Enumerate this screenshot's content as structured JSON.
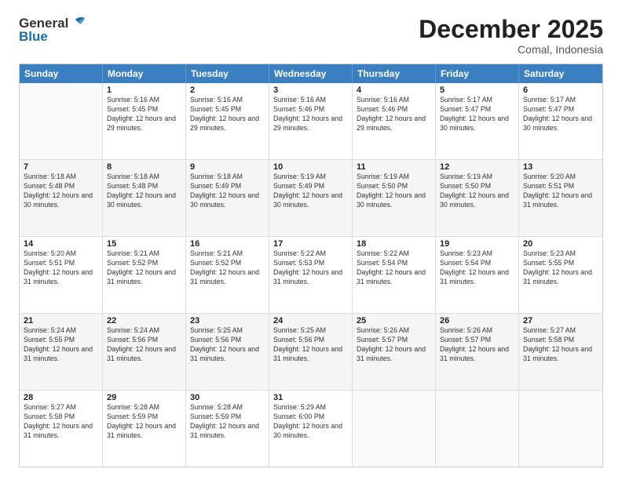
{
  "logo": {
    "general": "General",
    "blue": "Blue"
  },
  "title": "December 2025",
  "location": "Comal, Indonesia",
  "days_of_week": [
    "Sunday",
    "Monday",
    "Tuesday",
    "Wednesday",
    "Thursday",
    "Friday",
    "Saturday"
  ],
  "weeks": [
    [
      {
        "day": "",
        "sunrise": "",
        "sunset": "",
        "daylight": ""
      },
      {
        "day": "1",
        "sunrise": "Sunrise: 5:16 AM",
        "sunset": "Sunset: 5:45 PM",
        "daylight": "Daylight: 12 hours and 29 minutes."
      },
      {
        "day": "2",
        "sunrise": "Sunrise: 5:16 AM",
        "sunset": "Sunset: 5:45 PM",
        "daylight": "Daylight: 12 hours and 29 minutes."
      },
      {
        "day": "3",
        "sunrise": "Sunrise: 5:16 AM",
        "sunset": "Sunset: 5:46 PM",
        "daylight": "Daylight: 12 hours and 29 minutes."
      },
      {
        "day": "4",
        "sunrise": "Sunrise: 5:16 AM",
        "sunset": "Sunset: 5:46 PM",
        "daylight": "Daylight: 12 hours and 29 minutes."
      },
      {
        "day": "5",
        "sunrise": "Sunrise: 5:17 AM",
        "sunset": "Sunset: 5:47 PM",
        "daylight": "Daylight: 12 hours and 30 minutes."
      },
      {
        "day": "6",
        "sunrise": "Sunrise: 5:17 AM",
        "sunset": "Sunset: 5:47 PM",
        "daylight": "Daylight: 12 hours and 30 minutes."
      }
    ],
    [
      {
        "day": "7",
        "sunrise": "Sunrise: 5:18 AM",
        "sunset": "Sunset: 5:48 PM",
        "daylight": "Daylight: 12 hours and 30 minutes."
      },
      {
        "day": "8",
        "sunrise": "Sunrise: 5:18 AM",
        "sunset": "Sunset: 5:48 PM",
        "daylight": "Daylight: 12 hours and 30 minutes."
      },
      {
        "day": "9",
        "sunrise": "Sunrise: 5:18 AM",
        "sunset": "Sunset: 5:49 PM",
        "daylight": "Daylight: 12 hours and 30 minutes."
      },
      {
        "day": "10",
        "sunrise": "Sunrise: 5:19 AM",
        "sunset": "Sunset: 5:49 PM",
        "daylight": "Daylight: 12 hours and 30 minutes."
      },
      {
        "day": "11",
        "sunrise": "Sunrise: 5:19 AM",
        "sunset": "Sunset: 5:50 PM",
        "daylight": "Daylight: 12 hours and 30 minutes."
      },
      {
        "day": "12",
        "sunrise": "Sunrise: 5:19 AM",
        "sunset": "Sunset: 5:50 PM",
        "daylight": "Daylight: 12 hours and 30 minutes."
      },
      {
        "day": "13",
        "sunrise": "Sunrise: 5:20 AM",
        "sunset": "Sunset: 5:51 PM",
        "daylight": "Daylight: 12 hours and 31 minutes."
      }
    ],
    [
      {
        "day": "14",
        "sunrise": "Sunrise: 5:20 AM",
        "sunset": "Sunset: 5:51 PM",
        "daylight": "Daylight: 12 hours and 31 minutes."
      },
      {
        "day": "15",
        "sunrise": "Sunrise: 5:21 AM",
        "sunset": "Sunset: 5:52 PM",
        "daylight": "Daylight: 12 hours and 31 minutes."
      },
      {
        "day": "16",
        "sunrise": "Sunrise: 5:21 AM",
        "sunset": "Sunset: 5:52 PM",
        "daylight": "Daylight: 12 hours and 31 minutes."
      },
      {
        "day": "17",
        "sunrise": "Sunrise: 5:22 AM",
        "sunset": "Sunset: 5:53 PM",
        "daylight": "Daylight: 12 hours and 31 minutes."
      },
      {
        "day": "18",
        "sunrise": "Sunrise: 5:22 AM",
        "sunset": "Sunset: 5:54 PM",
        "daylight": "Daylight: 12 hours and 31 minutes."
      },
      {
        "day": "19",
        "sunrise": "Sunrise: 5:23 AM",
        "sunset": "Sunset: 5:54 PM",
        "daylight": "Daylight: 12 hours and 31 minutes."
      },
      {
        "day": "20",
        "sunrise": "Sunrise: 5:23 AM",
        "sunset": "Sunset: 5:55 PM",
        "daylight": "Daylight: 12 hours and 31 minutes."
      }
    ],
    [
      {
        "day": "21",
        "sunrise": "Sunrise: 5:24 AM",
        "sunset": "Sunset: 5:55 PM",
        "daylight": "Daylight: 12 hours and 31 minutes."
      },
      {
        "day": "22",
        "sunrise": "Sunrise: 5:24 AM",
        "sunset": "Sunset: 5:56 PM",
        "daylight": "Daylight: 12 hours and 31 minutes."
      },
      {
        "day": "23",
        "sunrise": "Sunrise: 5:25 AM",
        "sunset": "Sunset: 5:56 PM",
        "daylight": "Daylight: 12 hours and 31 minutes."
      },
      {
        "day": "24",
        "sunrise": "Sunrise: 5:25 AM",
        "sunset": "Sunset: 5:56 PM",
        "daylight": "Daylight: 12 hours and 31 minutes."
      },
      {
        "day": "25",
        "sunrise": "Sunrise: 5:26 AM",
        "sunset": "Sunset: 5:57 PM",
        "daylight": "Daylight: 12 hours and 31 minutes."
      },
      {
        "day": "26",
        "sunrise": "Sunrise: 5:26 AM",
        "sunset": "Sunset: 5:57 PM",
        "daylight": "Daylight: 12 hours and 31 minutes."
      },
      {
        "day": "27",
        "sunrise": "Sunrise: 5:27 AM",
        "sunset": "Sunset: 5:58 PM",
        "daylight": "Daylight: 12 hours and 31 minutes."
      }
    ],
    [
      {
        "day": "28",
        "sunrise": "Sunrise: 5:27 AM",
        "sunset": "Sunset: 5:58 PM",
        "daylight": "Daylight: 12 hours and 31 minutes."
      },
      {
        "day": "29",
        "sunrise": "Sunrise: 5:28 AM",
        "sunset": "Sunset: 5:59 PM",
        "daylight": "Daylight: 12 hours and 31 minutes."
      },
      {
        "day": "30",
        "sunrise": "Sunrise: 5:28 AM",
        "sunset": "Sunset: 5:59 PM",
        "daylight": "Daylight: 12 hours and 31 minutes."
      },
      {
        "day": "31",
        "sunrise": "Sunrise: 5:29 AM",
        "sunset": "Sunset: 6:00 PM",
        "daylight": "Daylight: 12 hours and 30 minutes."
      },
      {
        "day": "",
        "sunrise": "",
        "sunset": "",
        "daylight": ""
      },
      {
        "day": "",
        "sunrise": "",
        "sunset": "",
        "daylight": ""
      },
      {
        "day": "",
        "sunrise": "",
        "sunset": "",
        "daylight": ""
      }
    ]
  ]
}
